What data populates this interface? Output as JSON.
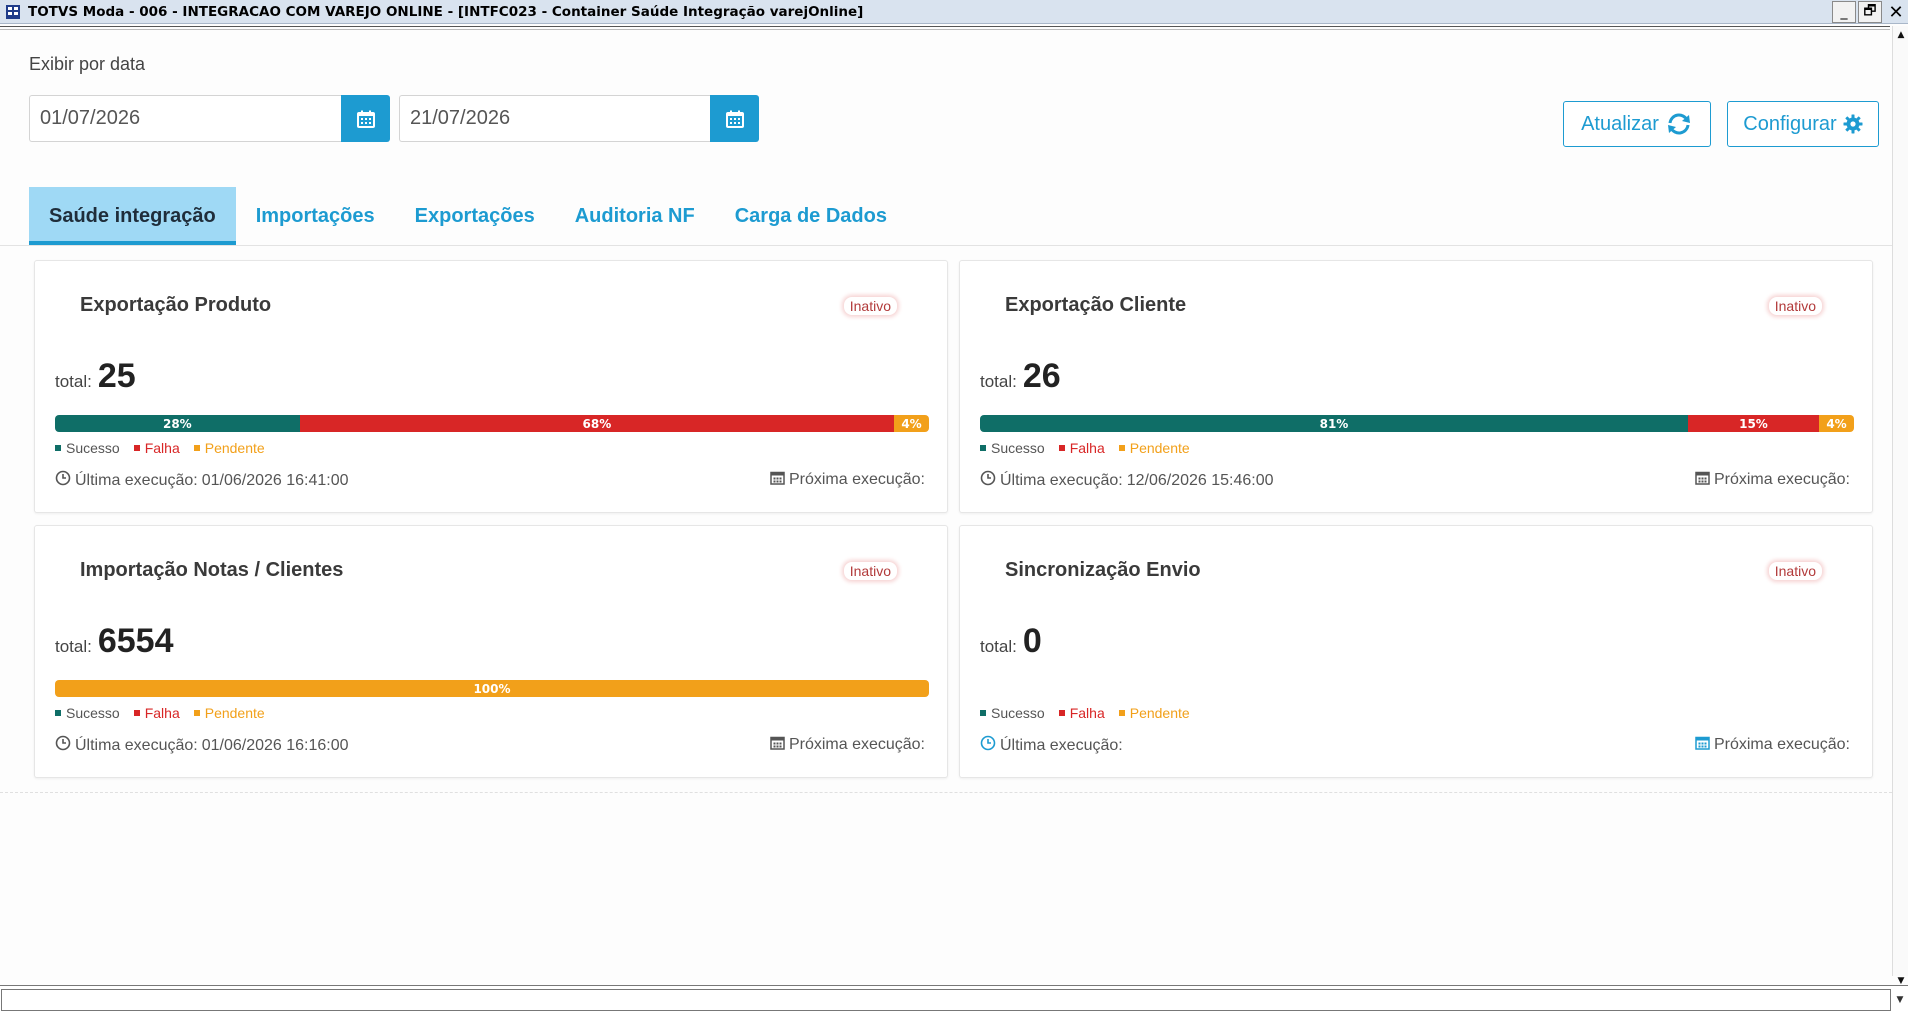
{
  "window": {
    "title": "TOTVS Moda - 006 - INTEGRACAO COM VAREJO ONLINE - [INTFC023 - Container Saúde Integração varejOnline]",
    "minimize_label": "_",
    "restore_label": "🗗",
    "close_label": "✕"
  },
  "filter": {
    "label": "Exibir por data",
    "start_date": "01/07/2026",
    "end_date": "21/07/2026"
  },
  "actions": {
    "refresh_label": "Atualizar",
    "configure_label": "Configurar"
  },
  "tabs": [
    {
      "label": "Saúde integração",
      "active": true
    },
    {
      "label": "Importações",
      "active": false
    },
    {
      "label": "Exportações",
      "active": false
    },
    {
      "label": "Auditoria NF",
      "active": false
    },
    {
      "label": "Carga de Dados",
      "active": false
    }
  ],
  "labels": {
    "total": "total:",
    "last_execution": "Última execução:",
    "next_execution": "Próxima execução:",
    "legend_success": "Sucesso",
    "legend_failure": "Falha",
    "legend_pending": "Pendente"
  },
  "colors": {
    "accent": "#1d9bd1",
    "success": "#0f6e67",
    "failure": "#d82626",
    "pending": "#f2a01a",
    "inactive": "#b23a3a"
  },
  "cards": [
    {
      "title": "Exportação Produto",
      "status": "Inativo",
      "total": "25",
      "bar": [
        {
          "label": "28%",
          "value": 28,
          "type": "success"
        },
        {
          "label": "68%",
          "value": 68,
          "type": "failure"
        },
        {
          "label": "4%",
          "value": 4,
          "type": "pending"
        }
      ],
      "last_execution": "01/06/2026 16:41:00",
      "next_execution": ""
    },
    {
      "title": "Exportação Cliente",
      "status": "Inativo",
      "total": "26",
      "bar": [
        {
          "label": "81%",
          "value": 81,
          "type": "success"
        },
        {
          "label": "15%",
          "value": 15,
          "type": "failure"
        },
        {
          "label": "4%",
          "value": 4,
          "type": "pending"
        }
      ],
      "last_execution": "12/06/2026 15:46:00",
      "next_execution": ""
    },
    {
      "title": "Importação Notas / Clientes",
      "status": "Inativo",
      "total": "6554",
      "bar": [
        {
          "label": "100%",
          "value": 100,
          "type": "pending"
        }
      ],
      "last_execution": "01/06/2026 16:16:00",
      "next_execution": ""
    },
    {
      "title": "Sincronização Envio",
      "status": "Inativo",
      "total": "0",
      "bar": [],
      "last_execution": "",
      "next_execution": ""
    }
  ]
}
